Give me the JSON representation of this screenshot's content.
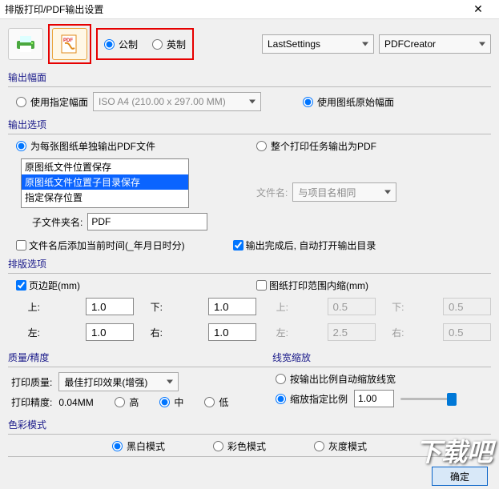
{
  "title": "排版打印/PDF输出设置",
  "unit": {
    "metric": "公制",
    "imperial": "英制"
  },
  "combos": {
    "settings": "LastSettings",
    "printer": "PDFCreator"
  },
  "frame": {
    "legend": "输出幅面",
    "use_specified": "使用指定幅面",
    "paper": "ISO A4 (210.00 x 297.00 MM)",
    "use_original": "使用图纸原始幅面"
  },
  "output_opts": {
    "legend": "输出选项",
    "each_pdf": "为每张图纸单独输出PDF文件",
    "whole_pdf": "整个打印任务输出为PDF",
    "list": [
      "原图纸文件位置保存",
      "原图纸文件位置子目录保存",
      "指定保存位置"
    ],
    "subfolder_label": "子文件夹名:",
    "subfolder_value": "PDF",
    "filename_label": "文件名:",
    "filename_value": "与项目名相同",
    "append_time": "文件名后添加当前时间(_年月日时分)",
    "auto_open": "输出完成后, 自动打开输出目录"
  },
  "layout": {
    "legend": "排版选项",
    "margin_chk": "页边距(mm)",
    "inset_chk": "图纸打印范围内缩(mm)",
    "top": "上:",
    "bottom": "下:",
    "left": "左:",
    "right": "右:",
    "m_top": "1.0",
    "m_bot": "1.0",
    "m_left": "1.0",
    "m_right": "1.0",
    "i_top": "0.5",
    "i_bot": "0.5",
    "i_left": "2.5",
    "i_right": "0.5"
  },
  "quality": {
    "legend": "质量/精度",
    "quality_label": "打印质量:",
    "quality_value": "最佳打印效果(增强)",
    "precision_label": "打印精度:",
    "precision_value": "0.04MM",
    "high": "高",
    "mid": "中",
    "low": "低"
  },
  "linewidth": {
    "legend": "线宽缩放",
    "auto": "按输出比例自动缩放线宽",
    "fixed": "缩放指定比例",
    "value": "1.00"
  },
  "colormode": {
    "legend": "色彩模式",
    "bw": "黑白模式",
    "color": "彩色模式",
    "gray": "灰度模式"
  },
  "ok": "确定",
  "watermark": "下载吧"
}
